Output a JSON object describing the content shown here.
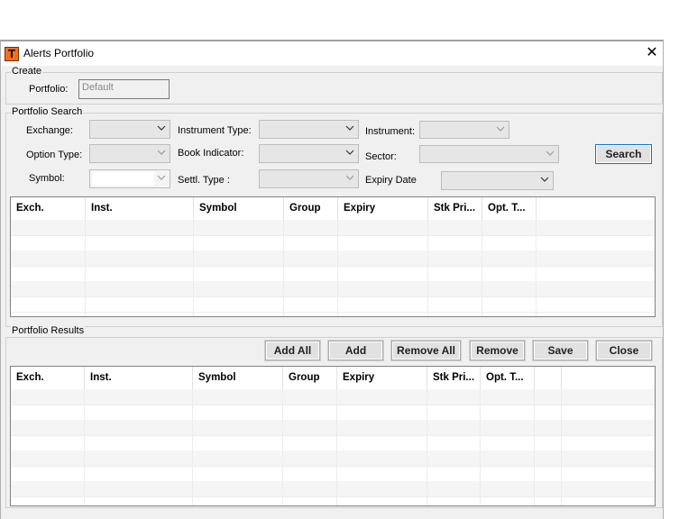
{
  "window": {
    "title": "Alerts Portfolio"
  },
  "create": {
    "group_label": "Create",
    "portfolio_label": "Portfolio:",
    "portfolio_value": "Default"
  },
  "search": {
    "group_label": "Portfolio Search",
    "exchange_label": "Exchange:",
    "instrument_type_label": "Instrument Type:",
    "instrument_label": "Instrument:",
    "option_type_label": "Option Type:",
    "book_indicator_label": "Book Indicator:",
    "sector_label": "Sector:",
    "symbol_label": "Symbol:",
    "settl_type_label": "Settl. Type   :",
    "expiry_date_label": "Expiry Date",
    "search_button": "Search"
  },
  "search_table": {
    "columns": [
      "Exch.",
      "Inst.",
      "Symbol",
      "Group",
      "Expiry",
      "Stk Pri...",
      "Opt. T..."
    ]
  },
  "results": {
    "group_label": "Portfolio Results",
    "add_all": "Add All",
    "add": "Add",
    "remove_all": "Remove All",
    "remove": "Remove",
    "save": "Save",
    "close": "Close"
  },
  "results_table": {
    "columns": [
      "Exch.",
      "Inst.",
      "Symbol",
      "Group",
      "Expiry",
      "Stk Pri...",
      "Opt. T..."
    ]
  }
}
